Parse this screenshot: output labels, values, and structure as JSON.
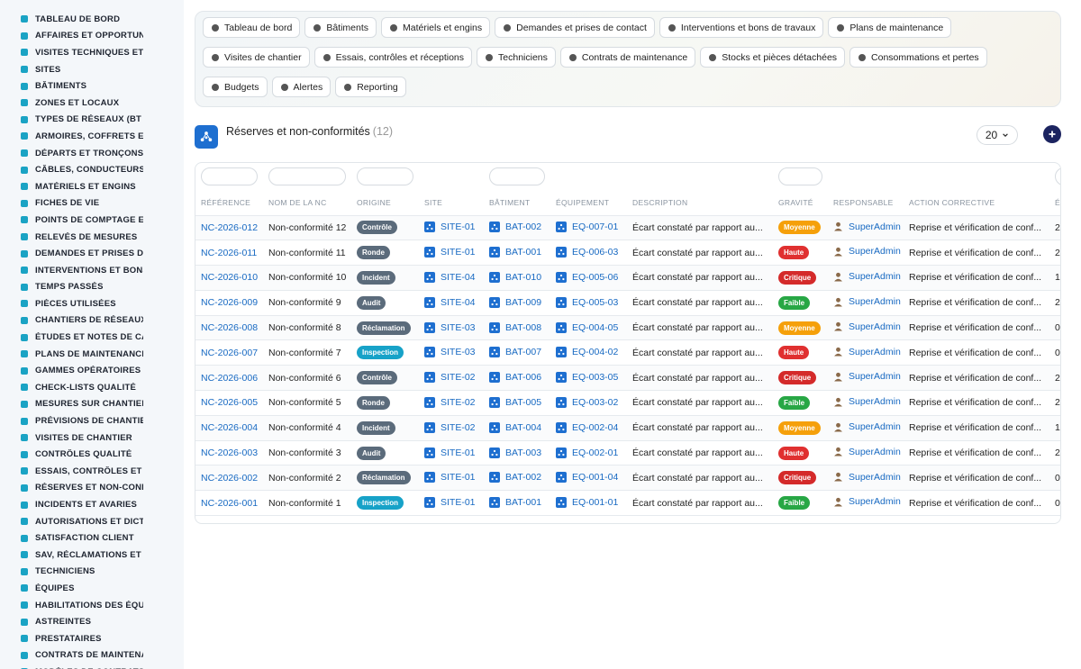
{
  "sidebar": {
    "items": [
      {
        "label": "Tableau de bord",
        "icon": "gauge-icon"
      },
      {
        "label": "Affaires et opportunités",
        "icon": "target-icon"
      },
      {
        "label": "Visites techniques et",
        "icon": "pin-icon"
      },
      {
        "label": "Sites",
        "icon": "map-pin-icon"
      },
      {
        "label": "Bâtiments",
        "icon": "building-icon"
      },
      {
        "label": "Zones et locaux",
        "icon": "grid-icon"
      },
      {
        "label": "Types de réseaux (BT / ...",
        "icon": "sitemap-icon"
      },
      {
        "label": "Armoires, coffrets et",
        "icon": "cabinet-icon"
      },
      {
        "label": "Départs et tronçons",
        "icon": "bolt-icon"
      },
      {
        "label": "Câbles, conducteurs",
        "icon": "lines-icon"
      },
      {
        "label": "Matériels et engins",
        "icon": "cogs-icon"
      },
      {
        "label": "Fiches de vie",
        "icon": "history-icon"
      },
      {
        "label": "Points de comptage et",
        "icon": "crosshair-icon"
      },
      {
        "label": "Relevés de mesures",
        "icon": "ruler-icon"
      },
      {
        "label": "Demandes et prises de",
        "icon": "clipboard-icon"
      },
      {
        "label": "Interventions et bons",
        "icon": "doc-icon"
      },
      {
        "label": "Temps passés",
        "icon": "clock-icon"
      },
      {
        "label": "Pièces utilisées",
        "icon": "puzzle-icon"
      },
      {
        "label": "Chantiers de réseaux",
        "icon": "hammer-icon"
      },
      {
        "label": "Études et notes de ca",
        "icon": "pencil-icon"
      },
      {
        "label": "Plans de maintenance",
        "icon": "calendar-icon"
      },
      {
        "label": "Gammes opératoires",
        "icon": "list-icon"
      },
      {
        "label": "Check-lists qualité",
        "icon": "checklist-icon"
      },
      {
        "label": "Mesures sur chantier",
        "icon": "thermometer-icon"
      },
      {
        "label": "Prévisions de chantie",
        "icon": "chart-icon"
      },
      {
        "label": "Visites de chantier",
        "icon": "route-icon"
      },
      {
        "label": "Contrôles qualité",
        "icon": "search-icon"
      },
      {
        "label": "Essais, contrôles et",
        "icon": "clipboard-check-icon"
      },
      {
        "label": "Réserves et non-conf",
        "icon": "exclamation-icon"
      },
      {
        "label": "Incidents et avaries",
        "icon": "warning-icon"
      },
      {
        "label": "Autorisations et dict",
        "icon": "signature-icon"
      },
      {
        "label": "Satisfaction client",
        "icon": "smile-icon"
      },
      {
        "label": "SAV, réclamations et",
        "icon": "headset-icon"
      },
      {
        "label": "Techniciens",
        "icon": "id-card-icon"
      },
      {
        "label": "Équipes",
        "icon": "users-icon"
      },
      {
        "label": "Habilitations des équ",
        "icon": "badge-icon"
      },
      {
        "label": "Astreintes",
        "icon": "phone-icon"
      },
      {
        "label": "Prestataires",
        "icon": "handshake-icon"
      },
      {
        "label": "Contrats de maintena",
        "icon": "file-contract-icon"
      },
      {
        "label": "Modèles de contrats",
        "icon": "file-icon"
      }
    ]
  },
  "nav": {
    "buttons": [
      {
        "label": "Tableau de bord",
        "icon": "gauge-icon"
      },
      {
        "label": "Bâtiments",
        "icon": "building-icon"
      },
      {
        "label": "Matériels et engins",
        "icon": "cogs-icon"
      },
      {
        "label": "Demandes et prises de contact",
        "icon": "question-icon"
      },
      {
        "label": "Interventions et bons de travaux",
        "icon": "clipboard-icon"
      },
      {
        "label": "Plans de maintenance",
        "icon": "calendar-icon"
      },
      {
        "label": "Visites de chantier",
        "icon": "route-icon"
      },
      {
        "label": "Essais, contrôles et réceptions",
        "icon": "clipboard-check-icon"
      },
      {
        "label": "Techniciens",
        "icon": "hardhat-icon"
      },
      {
        "label": "Contrats de maintenance",
        "icon": "file-contract-icon"
      },
      {
        "label": "Stocks et pièces détachées",
        "icon": "boxes-icon"
      },
      {
        "label": "Consommations et pertes",
        "icon": "bolt-icon"
      },
      {
        "label": "Budgets",
        "icon": "money-icon"
      },
      {
        "label": "Alertes",
        "icon": "bell-icon"
      },
      {
        "label": "Reporting",
        "icon": "pie-icon"
      }
    ]
  },
  "page": {
    "title": "Réserves et non-conformités",
    "count": "(12)",
    "page_size": "20"
  },
  "table": {
    "columns": [
      "RÉFÉRENCE",
      "NOM DE LA NC",
      "ORIGINE",
      "SITE",
      "BÂTIMENT",
      "ÉQUIPEMENT",
      "DESCRIPTION",
      "GRAVITÉ",
      "RESPONSABLE",
      "ACTION CORRECTIVE",
      "É"
    ],
    "rows": [
      {
        "ref": "NC-2026-012",
        "name": "Non-conformité 12",
        "origin": "Contrôle",
        "origin_color": "#5b6b7b",
        "site": "SITE-01",
        "bat": "BAT-002",
        "eq": "EQ-007-01",
        "desc": "Écart constaté par rapport au...",
        "gravity": "Moyenne",
        "gravity_color": "#f5a00a",
        "resp": "SuperAdmin",
        "action": "Reprise et vérification de conf...",
        "extra": "2"
      },
      {
        "ref": "NC-2026-011",
        "name": "Non-conformité 11",
        "origin": "Ronde",
        "origin_color": "#5b6b7b",
        "site": "SITE-01",
        "bat": "BAT-001",
        "eq": "EQ-006-03",
        "desc": "Écart constaté par rapport au...",
        "gravity": "Haute",
        "gravity_color": "#e03030",
        "resp": "SuperAdmin",
        "action": "Reprise et vérification de conf...",
        "extra": "2"
      },
      {
        "ref": "NC-2026-010",
        "name": "Non-conformité 10",
        "origin": "Incident",
        "origin_color": "#5b6b7b",
        "site": "SITE-04",
        "bat": "BAT-010",
        "eq": "EQ-005-06",
        "desc": "Écart constaté par rapport au...",
        "gravity": "Critique",
        "gravity_color": "#d42a2a",
        "resp": "SuperAdmin",
        "action": "Reprise et vérification de conf...",
        "extra": "1"
      },
      {
        "ref": "NC-2026-009",
        "name": "Non-conformité 9",
        "origin": "Audit",
        "origin_color": "#5b6b7b",
        "site": "SITE-04",
        "bat": "BAT-009",
        "eq": "EQ-005-03",
        "desc": "Écart constaté par rapport au...",
        "gravity": "Faible",
        "gravity_color": "#28a745",
        "resp": "SuperAdmin",
        "action": "Reprise et vérification de conf...",
        "extra": "2"
      },
      {
        "ref": "NC-2026-008",
        "name": "Non-conformité 8",
        "origin": "Réclamation",
        "origin_color": "#5b6b7b",
        "site": "SITE-03",
        "bat": "BAT-008",
        "eq": "EQ-004-05",
        "desc": "Écart constaté par rapport au...",
        "gravity": "Moyenne",
        "gravity_color": "#f5a00a",
        "resp": "SuperAdmin",
        "action": "Reprise et vérification de conf...",
        "extra": "0"
      },
      {
        "ref": "NC-2026-007",
        "name": "Non-conformité 7",
        "origin": "Inspection",
        "origin_color": "#17a2c8",
        "site": "SITE-03",
        "bat": "BAT-007",
        "eq": "EQ-004-02",
        "desc": "Écart constaté par rapport au...",
        "gravity": "Haute",
        "gravity_color": "#e03030",
        "resp": "SuperAdmin",
        "action": "Reprise et vérification de conf...",
        "extra": "0"
      },
      {
        "ref": "NC-2026-006",
        "name": "Non-conformité 6",
        "origin": "Contrôle",
        "origin_color": "#5b6b7b",
        "site": "SITE-02",
        "bat": "BAT-006",
        "eq": "EQ-003-05",
        "desc": "Écart constaté par rapport au...",
        "gravity": "Critique",
        "gravity_color": "#d42a2a",
        "resp": "SuperAdmin",
        "action": "Reprise et vérification de conf...",
        "extra": "2"
      },
      {
        "ref": "NC-2026-005",
        "name": "Non-conformité 5",
        "origin": "Ronde",
        "origin_color": "#5b6b7b",
        "site": "SITE-02",
        "bat": "BAT-005",
        "eq": "EQ-003-02",
        "desc": "Écart constaté par rapport au...",
        "gravity": "Faible",
        "gravity_color": "#28a745",
        "resp": "SuperAdmin",
        "action": "Reprise et vérification de conf...",
        "extra": "2"
      },
      {
        "ref": "NC-2026-004",
        "name": "Non-conformité 4",
        "origin": "Incident",
        "origin_color": "#5b6b7b",
        "site": "SITE-02",
        "bat": "BAT-004",
        "eq": "EQ-002-04",
        "desc": "Écart constaté par rapport au...",
        "gravity": "Moyenne",
        "gravity_color": "#f5a00a",
        "resp": "SuperAdmin",
        "action": "Reprise et vérification de conf...",
        "extra": "1"
      },
      {
        "ref": "NC-2026-003",
        "name": "Non-conformité 3",
        "origin": "Audit",
        "origin_color": "#5b6b7b",
        "site": "SITE-01",
        "bat": "BAT-003",
        "eq": "EQ-002-01",
        "desc": "Écart constaté par rapport au...",
        "gravity": "Haute",
        "gravity_color": "#e03030",
        "resp": "SuperAdmin",
        "action": "Reprise et vérification de conf...",
        "extra": "2"
      },
      {
        "ref": "NC-2026-002",
        "name": "Non-conformité 2",
        "origin": "Réclamation",
        "origin_color": "#5b6b7b",
        "site": "SITE-01",
        "bat": "BAT-002",
        "eq": "EQ-001-04",
        "desc": "Écart constaté par rapport au...",
        "gravity": "Critique",
        "gravity_color": "#d42a2a",
        "resp": "SuperAdmin",
        "action": "Reprise et vérification de conf...",
        "extra": "0"
      },
      {
        "ref": "NC-2026-001",
        "name": "Non-conformité 1",
        "origin": "Inspection",
        "origin_color": "#17a2c8",
        "site": "SITE-01",
        "bat": "BAT-001",
        "eq": "EQ-001-01",
        "desc": "Écart constaté par rapport au...",
        "gravity": "Faible",
        "gravity_color": "#28a745",
        "resp": "SuperAdmin",
        "action": "Reprise et vérification de conf...",
        "extra": "0"
      }
    ]
  },
  "colors": {
    "accent": "#1769c2",
    "sidebar_icon": "#1aa3c4",
    "add_button": "#1c2460"
  }
}
